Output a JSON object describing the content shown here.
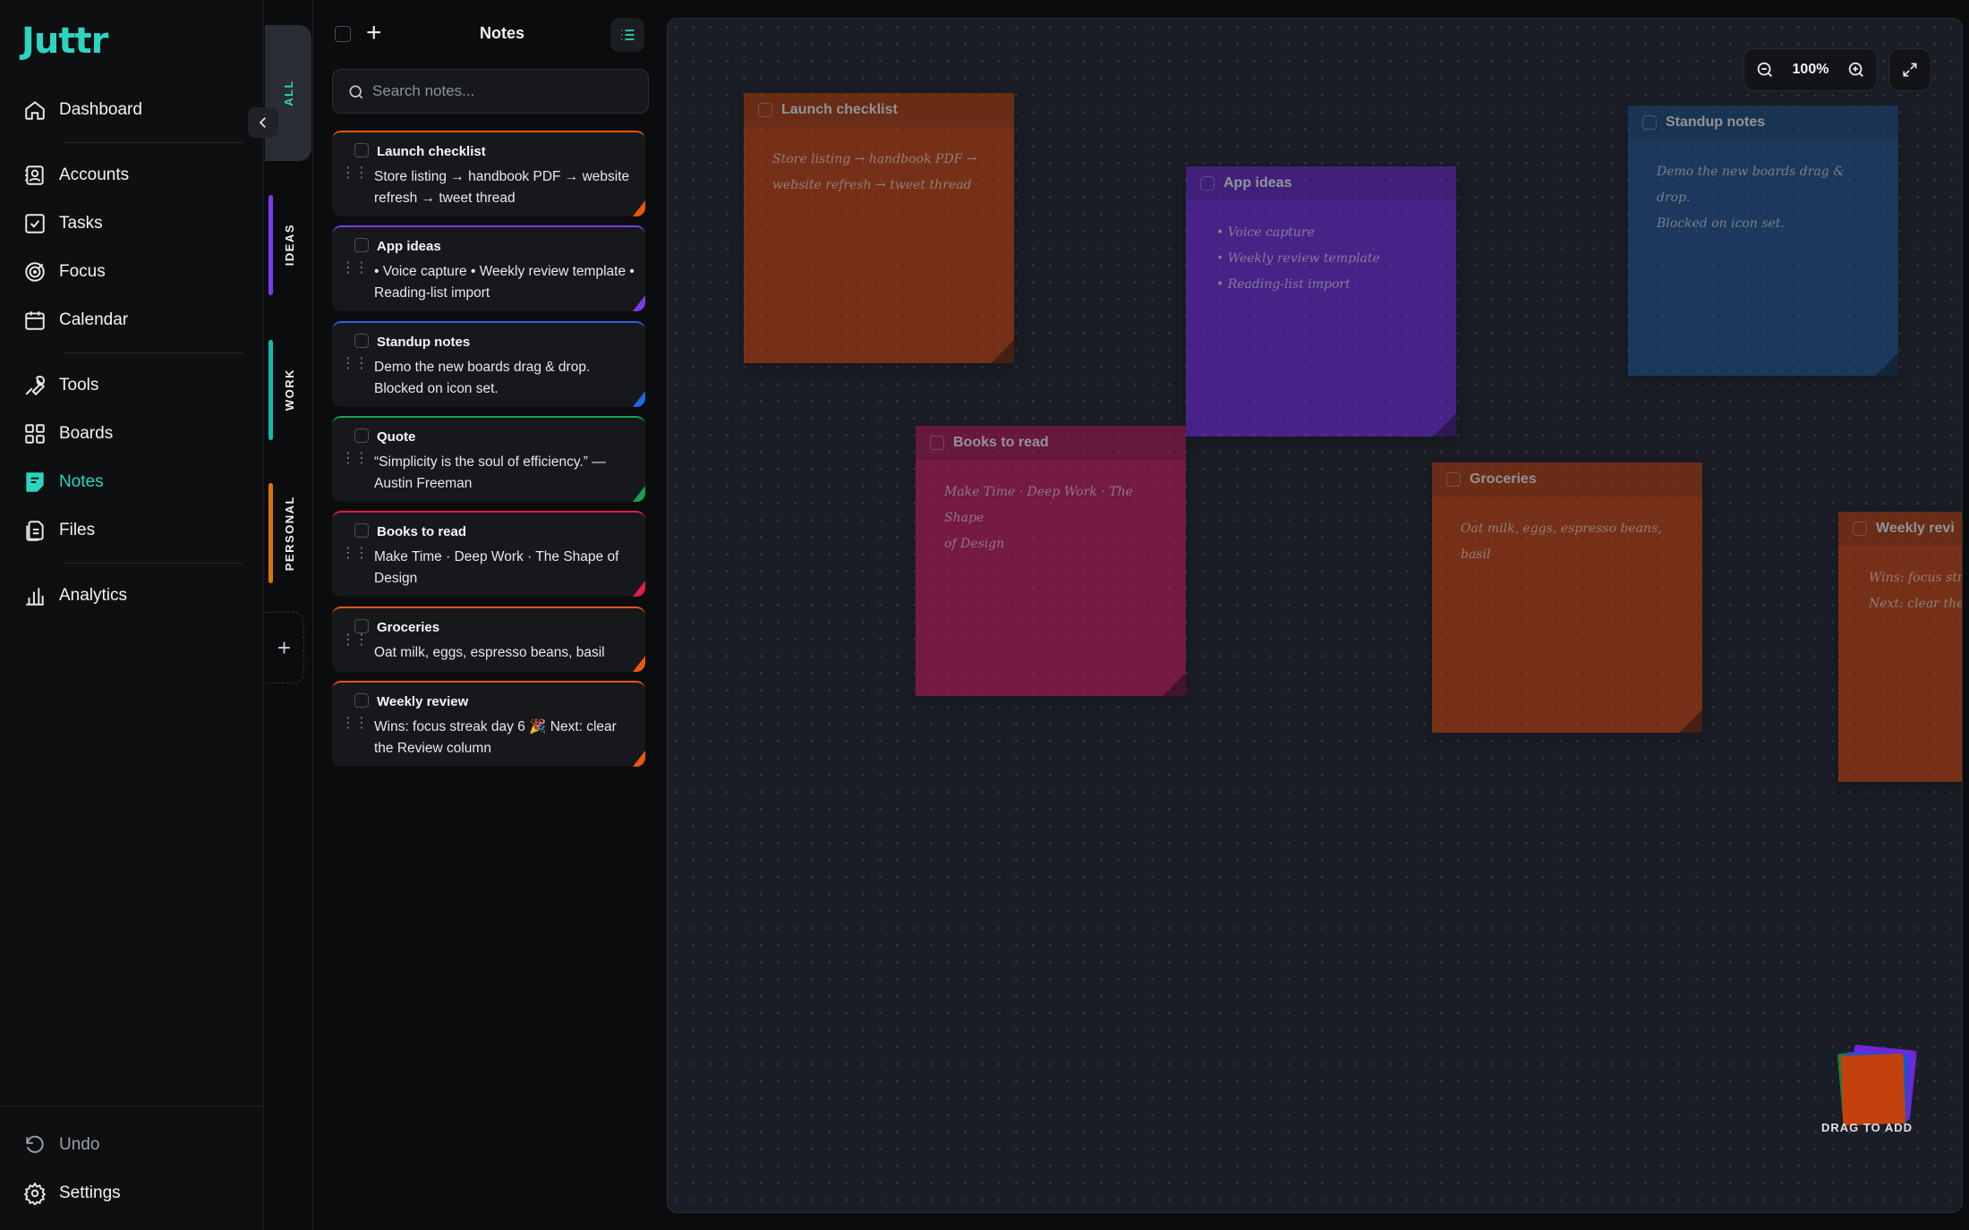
{
  "app": {
    "logo": "Juttr"
  },
  "sidebar": {
    "items": [
      {
        "label": "Dashboard",
        "icon": "home-icon"
      },
      {
        "label": "Accounts",
        "icon": "contact-icon"
      },
      {
        "label": "Tasks",
        "icon": "checkbox-icon"
      },
      {
        "label": "Focus",
        "icon": "target-icon"
      },
      {
        "label": "Calendar",
        "icon": "calendar-icon"
      },
      {
        "label": "Tools",
        "icon": "wrench-icon"
      },
      {
        "label": "Boards",
        "icon": "grid-icon"
      },
      {
        "label": "Notes",
        "icon": "note-icon",
        "active": true
      },
      {
        "label": "Files",
        "icon": "files-icon"
      },
      {
        "label": "Analytics",
        "icon": "bar-chart-icon"
      }
    ],
    "bottom": {
      "undo": "Undo",
      "settings": "Settings"
    }
  },
  "folders": [
    {
      "label": "ALL",
      "color": "#2dd4bf",
      "active": true
    },
    {
      "label": "IDEAS",
      "color": "#7c3aed"
    },
    {
      "label": "WORK",
      "color": "#14b8a6"
    },
    {
      "label": "PERSONAL",
      "color": "#d97706"
    }
  ],
  "notes_list": {
    "title": "Notes",
    "search_placeholder": "Search notes...",
    "notes": [
      {
        "title": "Launch checklist",
        "body": "Store listing → handbook PDF → website refresh → tweet thread",
        "color": "#ea580c"
      },
      {
        "title": "App ideas",
        "body": "• Voice capture • Weekly review template • Reading-list import",
        "color": "#7c3aed"
      },
      {
        "title": "Standup notes",
        "body": "Demo the new boards drag & drop. Blocked on icon set.",
        "color": "#2563eb"
      },
      {
        "title": "Quote",
        "body": "“Simplicity is the soul of efficiency.” — Austin Freeman",
        "color": "#16a34a"
      },
      {
        "title": "Books to read",
        "body": "Make Time · Deep Work · The Shape of Design",
        "color": "#e11d48"
      },
      {
        "title": "Groceries",
        "body": "Oat milk, eggs, espresso beans, basil",
        "color": "#ea580c"
      },
      {
        "title": "Weekly review",
        "body": "Wins: focus streak day 6 🎉 Next: clear the Review column",
        "color": "#ea580c"
      }
    ]
  },
  "canvas": {
    "zoom": "100%",
    "stickies": [
      {
        "title": "Launch checklist",
        "body": "Store listing → handbook PDF →\nwebsite refresh → tweet thread",
        "color": "#c2410c"
      },
      {
        "title": "App ideas",
        "body": "• Voice capture\n• Weekly review template\n• Reading-list import",
        "color": "#6d28d9"
      },
      {
        "title": "Standup notes",
        "body": "Demo the new boards drag & drop.\nBlocked on icon set.",
        "color": "#1e4f8a"
      },
      {
        "title": "Books to read",
        "body": "Make Time · Deep Work · The Shape\nof Design",
        "color": "#be185d"
      },
      {
        "title": "Groceries",
        "body": "Oat milk, eggs, espresso beans, basil",
        "color": "#c2410c"
      },
      {
        "title": "Weekly revi",
        "body": "Wins: focus stre\nNext: clear the R",
        "color": "#c2410c"
      }
    ],
    "drag_label": "DRAG TO ADD"
  }
}
